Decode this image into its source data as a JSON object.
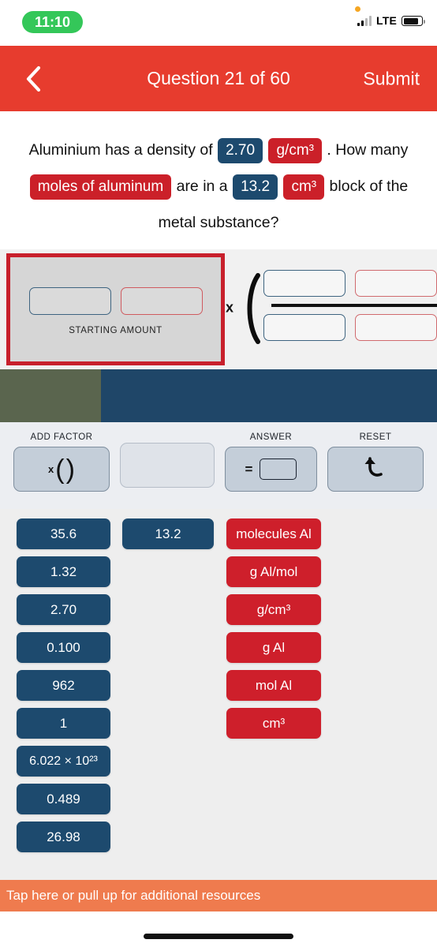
{
  "status_bar": {
    "time": "11:10",
    "network": "LTE",
    "recording_indicator": "orange-dot",
    "signal_icon": "cellular-signal-icon",
    "battery_icon": "battery-icon"
  },
  "header": {
    "back_icon": "chevron-left-icon",
    "title": "Question 21 of 60",
    "submit_label": "Submit",
    "background_color": "#e73c2e"
  },
  "question": {
    "parts": [
      {
        "type": "text",
        "value": "Aluminium has a density of"
      },
      {
        "type": "token",
        "style": "blue",
        "value": "2.70"
      },
      {
        "type": "token",
        "style": "red",
        "value": "g/cm³"
      },
      {
        "type": "text",
        "value": ". How many"
      },
      {
        "type": "token",
        "style": "red",
        "value": "moles of aluminum"
      },
      {
        "type": "text",
        "value": "are in a"
      },
      {
        "type": "token",
        "style": "blue",
        "value": "13.2"
      },
      {
        "type": "token",
        "style": "red",
        "value": "cm³"
      },
      {
        "type": "text",
        "value": "block of the metal substance?"
      }
    ],
    "plain_text": "Aluminium has a density of 2.70 g/cm³ . How many moles of aluminum are in a 13.2 cm³ block of the metal substance?"
  },
  "work_area": {
    "starting_amount_label": "STARTING AMOUNT",
    "starting_amount_selected": true,
    "starting_value_slot": "",
    "starting_unit_slot": "",
    "multiply_symbol": "x",
    "open_paren": "(",
    "numerator_value_slot": "",
    "numerator_unit_slot": "",
    "denominator_value_slot": "",
    "denominator_unit_slot": "",
    "selection_color": "#c8202c"
  },
  "toolbar": {
    "add_factor_label": "ADD FACTOR",
    "add_factor_glyph_x": "x",
    "add_factor_glyph_open": "(",
    "add_factor_glyph_close": ")",
    "answer_label": "ANSWER",
    "answer_glyph": "=",
    "reset_label": "RESET",
    "reset_icon": "undo-arrow-icon"
  },
  "bank": {
    "value_tiles_col1": [
      "35.6",
      "1.32",
      "2.70",
      "0.100",
      "962",
      "1",
      "6.022 × 10²³",
      "0.489",
      "26.98"
    ],
    "value_tiles_col2": [
      "13.2"
    ],
    "unit_tiles_col3": [
      "molecules Al",
      "g Al/mol",
      "g/cm³",
      "g Al",
      "mol Al",
      "cm³"
    ],
    "value_color": "#1d4a6e",
    "unit_color": "#ce1f2b"
  },
  "footer": {
    "resources_text": "Tap here or pull up for additional resources",
    "background_color": "#ef7b4e",
    "home_indicator": "home-indicator"
  }
}
